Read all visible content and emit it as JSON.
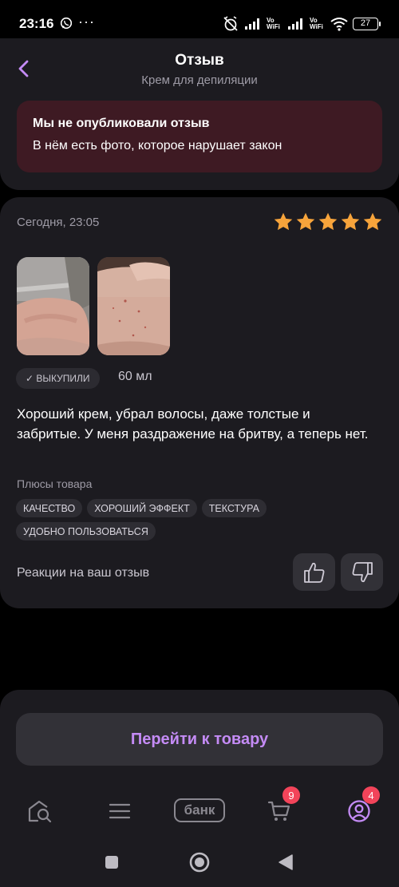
{
  "status_bar": {
    "time": "23:16",
    "dots": "···",
    "network_label_1": "Vo WiFi",
    "network_label_2": "Vo WiFi",
    "battery": "27"
  },
  "header": {
    "title": "Отзыв",
    "subtitle": "Крем для депиляции",
    "back_icon": "chevron-left-icon"
  },
  "alert": {
    "title": "Мы не опубликовали отзыв",
    "text": "В нём есть фото, которое нарушает закон"
  },
  "review": {
    "date": "Сегодня, 23:05",
    "rating": 5,
    "star_color": "#f7a43b",
    "bought_badge": "✓ ВЫКУПИЛИ",
    "volume": "60 мл",
    "text": "Хороший крем, убрал волосы, даже толстые и забритые. У меня раздражение на бритву, а теперь нет.",
    "pros_title": "Плюсы товара",
    "pros_tags": [
      "КАЧЕСТВО",
      "ХОРОШИЙ ЭФФЕКТ",
      "ТЕКСТУРА",
      "УДОБНО ПОЛЬЗОВАТЬСЯ"
    ],
    "reactions_label": "Реакции на ваш отзыв"
  },
  "cta": {
    "label": "Перейти к товару",
    "color": "#c48bf5"
  },
  "tabbar": {
    "bank_label": "банк",
    "cart_badge": "9",
    "profile_badge": "4",
    "badge_color": "#f2445a"
  },
  "colors": {
    "background": "#000000",
    "card": "#1c1b20",
    "alert_bg": "#3e1a23",
    "accent": "#c48bf5"
  }
}
